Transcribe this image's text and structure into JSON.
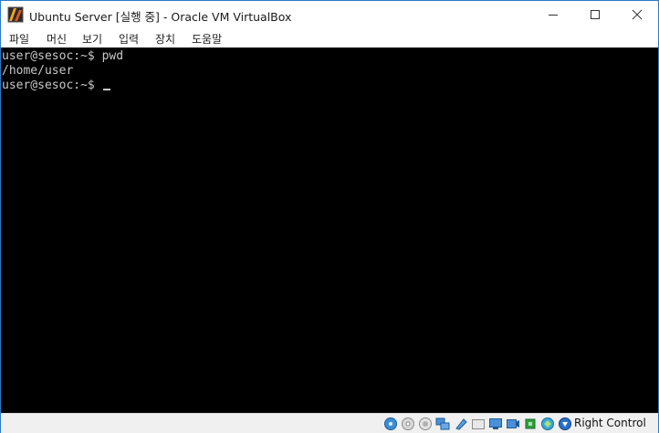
{
  "window": {
    "title": "Ubuntu Server [실행 중] - Oracle VM VirtualBox",
    "border_color": "#2b79c9"
  },
  "menu": {
    "items": [
      "파일",
      "머신",
      "보기",
      "입력",
      "장치",
      "도움말"
    ]
  },
  "terminal": {
    "background": "#000000",
    "foreground": "#c8c8c8",
    "lines": [
      "user@sesoc:~$ pwd",
      "/home/user",
      "user@sesoc:~$ "
    ]
  },
  "statusbar": {
    "icons": [
      "hard-disk-icon",
      "optical-drive-icon",
      "audio-icon",
      "network-icon",
      "usb-icon",
      "shared-folders-icon",
      "display-icon",
      "video-capture-icon",
      "cpu-icon",
      "mouse-integration-icon",
      "keyboard-icon"
    ],
    "host_key_label": "Right Control"
  }
}
